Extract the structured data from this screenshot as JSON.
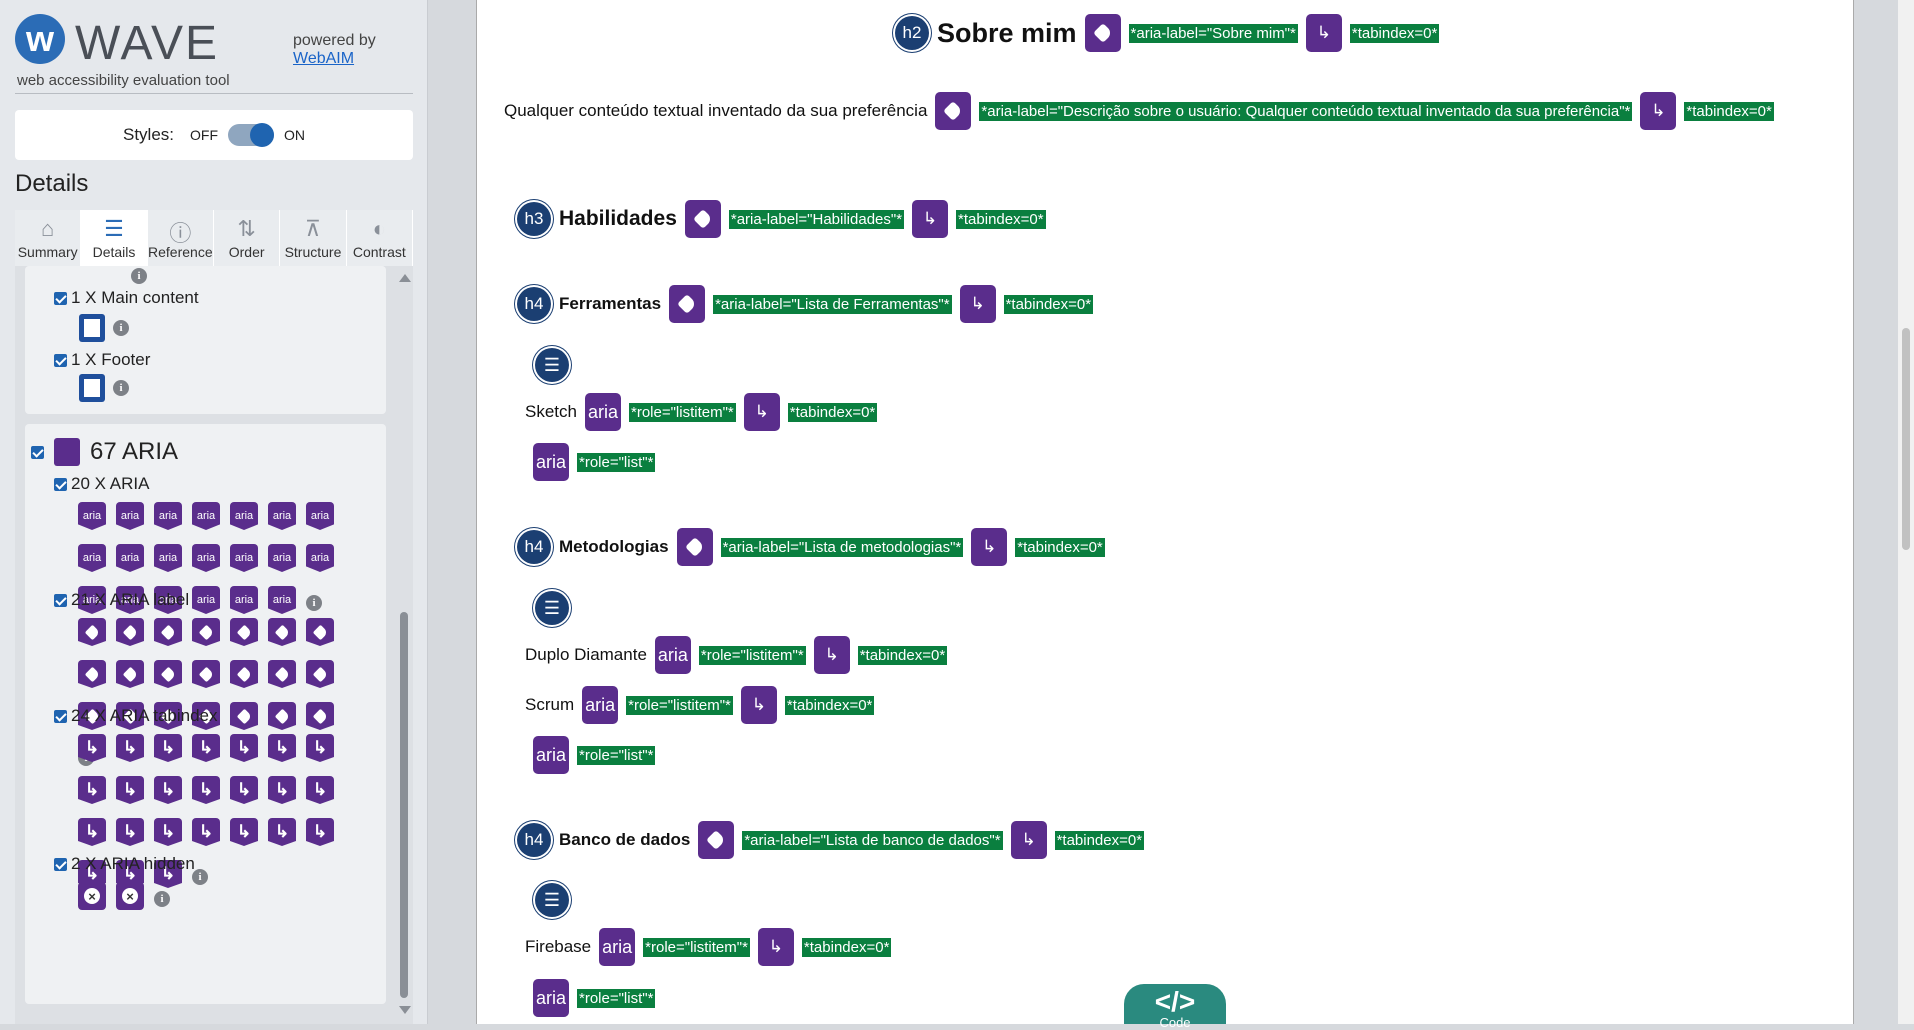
{
  "sidebar": {
    "brand": "WAVE",
    "tagline": "web accessibility evaluation tool",
    "powered_by": "powered by",
    "webaim_link": "WebAIM",
    "styles_label": "Styles:",
    "styles_off": "OFF",
    "styles_on": "ON",
    "details_title": "Details",
    "tabs": [
      {
        "label": "Summary",
        "icon": "home-icon"
      },
      {
        "label": "Details",
        "icon": "list-icon",
        "active": true
      },
      {
        "label": "Reference",
        "icon": "info-icon"
      },
      {
        "label": "Order",
        "icon": "order-icon"
      },
      {
        "label": "Structure",
        "icon": "structure-icon"
      },
      {
        "label": "Contrast",
        "icon": "contrast-icon"
      }
    ],
    "landmarks": [
      {
        "label": "1 X Main content"
      },
      {
        "label": "1 X Footer"
      }
    ],
    "aria": {
      "total": "67 ARIA",
      "groups": [
        {
          "label": "20 X ARIA",
          "count": 20,
          "icon_text": "aria"
        },
        {
          "label": "21 X ARIA label",
          "count": 21
        },
        {
          "label": "24 X ARIA tabindex",
          "count": 24
        },
        {
          "label": "2 X ARIA hidden",
          "count": 2
        }
      ]
    }
  },
  "main": {
    "h2_label": "h2",
    "h3_label": "h3",
    "h4_label": "h4",
    "sobre_mim": "Sobre mim",
    "sobre_mim_aria": "*aria-label=\"Sobre mim\"*",
    "tabindex": "*tabindex=0*",
    "descricao": "Qualquer conteúdo textual inventado da sua preferência",
    "descricao_aria": "*aria-label=\"Descrição sobre o usuário: Qualquer conteúdo textual inventado da sua preferência\"*",
    "habilidades": "Habilidades",
    "habilidades_aria": "*aria-label=\"Habilidades\"*",
    "ferramentas": "Ferramentas",
    "ferramentas_aria": "*aria-label=\"Lista de Ferramentas\"*",
    "sketch": "Sketch",
    "role_listitem": "*role=\"listitem\"*",
    "role_list": "*role=\"list\"*",
    "aria_text": "aria",
    "metodologias": "Metodologias",
    "metodologias_aria": "*aria-label=\"Lista de metodologias\"*",
    "duplo": "Duplo Diamante",
    "scrum": "Scrum",
    "banco": "Banco de dados",
    "banco_aria": "*aria-label=\"Lista de banco de dados\"*",
    "firebase": "Firebase",
    "code_label": "Code"
  }
}
